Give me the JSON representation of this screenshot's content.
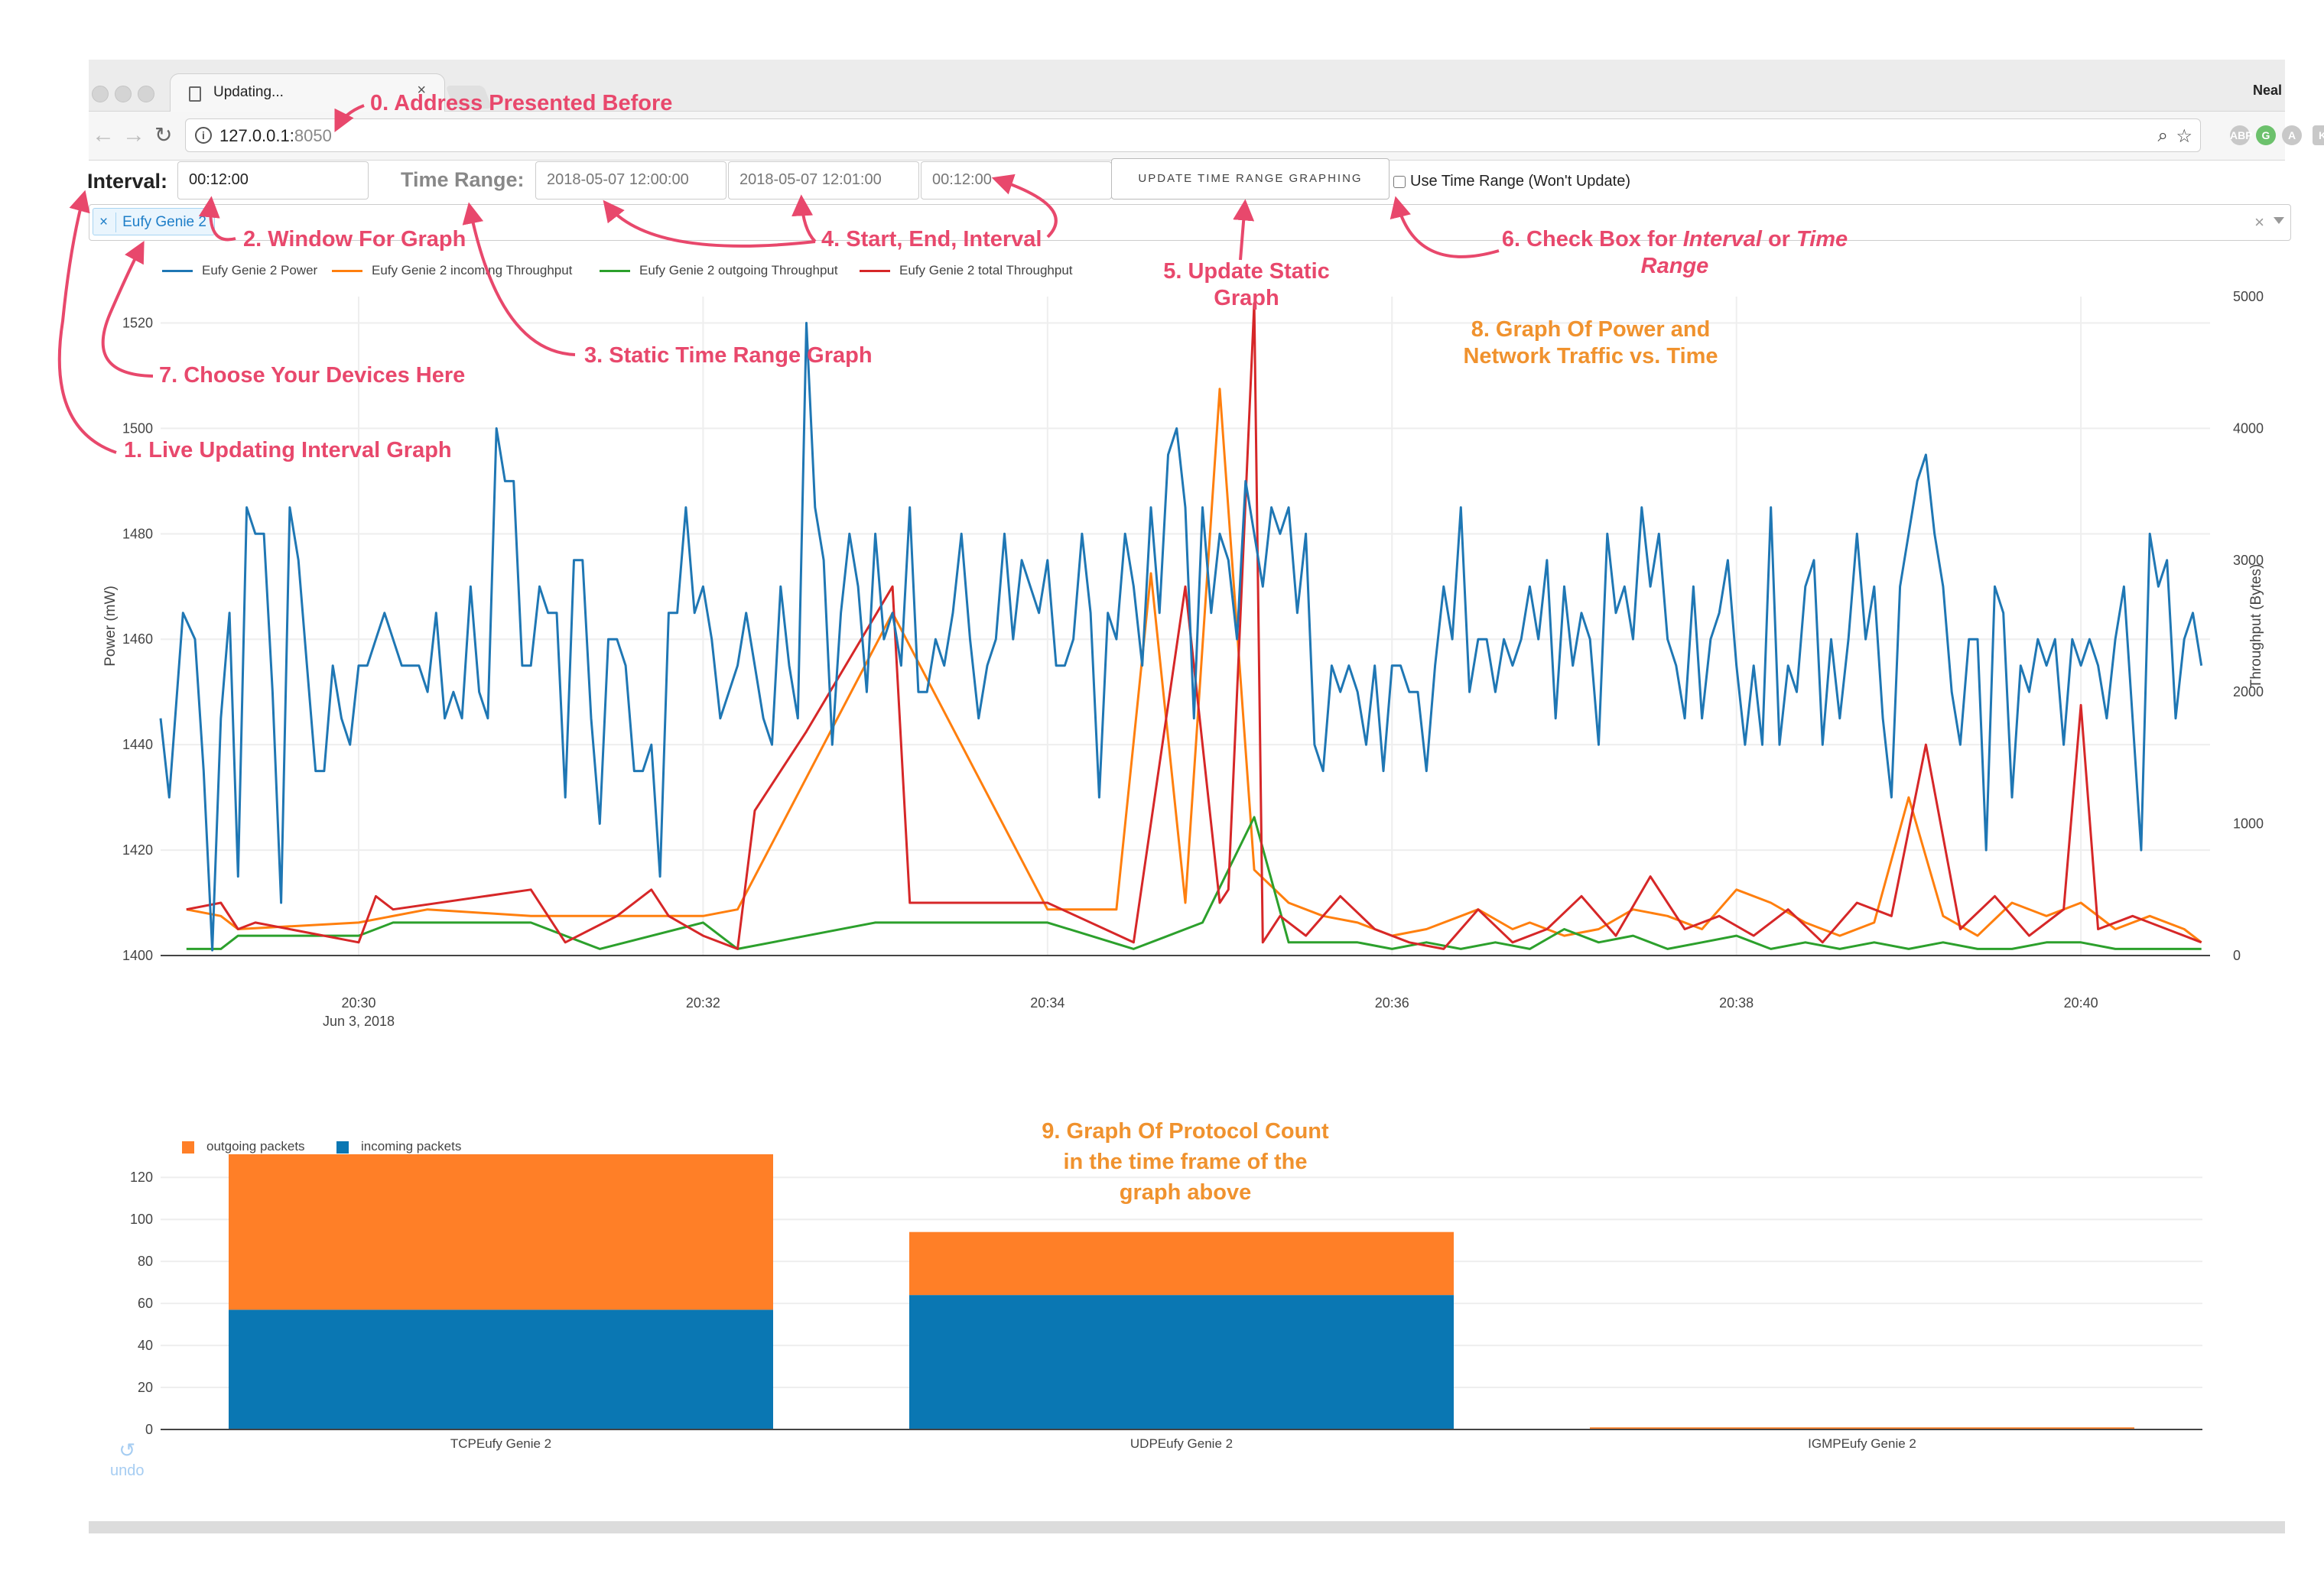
{
  "browser": {
    "tab_title": "Updating...",
    "profile_name": "Neal",
    "url_host": "127.0.0.1:",
    "url_port": "8050",
    "extensions": [
      "ABP",
      "G",
      "A",
      "K"
    ]
  },
  "controls": {
    "interval_label": "Interval:",
    "interval_value": "00:12:00",
    "time_range_label": "Time Range:",
    "start_value": "2018-05-07 12:00:00",
    "end_value": "2018-05-07 12:01:00",
    "range_interval_value": "00:12:00",
    "update_button": "UPDATE TIME RANGE GRAPHING",
    "checkbox_label": "Use Time Range (Won't Update)",
    "selected_device": "Eufy Genie 2"
  },
  "colors": {
    "power": "#1f77b4",
    "incoming": "#ff7f0e",
    "outgoing": "#2ca02c",
    "total": "#d62728",
    "annotation": "#e8486c",
    "annotation_orange": "#f0922e",
    "bar_outgoing": "#ff7f27",
    "bar_incoming": "#0a77b3"
  },
  "annotations": {
    "a0": "0. Address Presented Before",
    "a1": "1. Live Updating Interval Graph",
    "a2": "2. Window For Graph",
    "a3": "3. Static Time Range Graph",
    "a4": "4. Start, End, Interval",
    "a5_line1": "5. Update Static",
    "a5_line2": "Graph",
    "a6_prefix": "6. Check Box for ",
    "a6_em1": "Interval",
    "a6_mid": " or ",
    "a6_em2": "Time",
    "a6_line2": "Range",
    "a7": "7. Choose Your Devices Here",
    "a8_line1": "8. Graph Of Power and",
    "a8_line2": "Network Traffic vs. Time",
    "a9_line1": "9. Graph Of Protocol Count",
    "a9_line2": "in the time frame of the",
    "a9_line3": "graph above"
  },
  "undo_label": "undo",
  "chart_data": [
    {
      "type": "line",
      "ylabel": "Power (mW)",
      "y2label": "Throughput (Bytes)",
      "ylim": [
        1400,
        1525
      ],
      "y2lim": [
        0,
        5000
      ],
      "yticks": [
        1400,
        1420,
        1440,
        1460,
        1480,
        1500,
        1520
      ],
      "y2ticks": [
        0,
        1000,
        2000,
        3000,
        4000,
        5000
      ],
      "xlim_minutes": [
        28.85,
        40.75
      ],
      "xticks": [
        {
          "x": 30,
          "label": "20:30",
          "sub": "Jun 3, 2018"
        },
        {
          "x": 32,
          "label": "20:32",
          "sub": ""
        },
        {
          "x": 34,
          "label": "20:34",
          "sub": ""
        },
        {
          "x": 36,
          "label": "20:36",
          "sub": ""
        },
        {
          "x": 38,
          "label": "20:38",
          "sub": ""
        },
        {
          "x": 40,
          "label": "20:40",
          "sub": ""
        }
      ],
      "series": [
        {
          "name": "Eufy Genie 2 Power",
          "axis": "y",
          "color": "#1f77b4",
          "x": [
            28.85,
            28.9,
            28.98,
            29.05,
            29.1,
            29.15,
            29.2,
            29.25,
            29.3,
            29.35,
            29.4,
            29.45,
            29.5,
            29.55,
            29.6,
            29.65,
            29.7,
            29.75,
            29.8,
            29.85,
            29.9,
            29.95,
            30.0,
            30.05,
            30.1,
            30.15,
            30.2,
            30.25,
            30.3,
            30.35,
            30.4,
            30.45,
            30.5,
            30.55,
            30.6,
            30.65,
            30.7,
            30.75,
            30.8,
            30.85,
            30.9,
            30.95,
            31.0,
            31.05,
            31.1,
            31.15,
            31.2,
            31.25,
            31.3,
            31.35,
            31.4,
            31.45,
            31.5,
            31.55,
            31.6,
            31.65,
            31.7,
            31.75,
            31.8,
            31.85,
            31.9,
            31.95,
            32.0,
            32.05,
            32.1,
            32.15,
            32.2,
            32.25,
            32.3,
            32.35,
            32.4,
            32.45,
            32.5,
            32.55,
            32.6,
            32.65,
            32.7,
            32.75,
            32.8,
            32.85,
            32.9,
            32.95,
            33.0,
            33.05,
            33.1,
            33.15,
            33.2,
            33.25,
            33.3,
            33.35,
            33.4,
            33.45,
            33.5,
            33.55,
            33.6,
            33.65,
            33.7,
            33.75,
            33.8,
            33.85,
            33.9,
            33.95,
            34.0,
            34.05,
            34.1,
            34.15,
            34.2,
            34.25,
            34.3,
            34.35,
            34.4,
            34.45,
            34.5,
            34.55,
            34.6,
            34.65,
            34.7,
            34.75,
            34.8,
            34.85,
            34.9,
            34.95,
            35.0,
            35.05,
            35.1,
            35.15,
            35.2,
            35.25,
            35.3,
            35.35,
            35.4,
            35.45,
            35.5,
            35.55,
            35.6,
            35.65,
            35.7,
            35.75,
            35.8,
            35.85,
            35.9,
            35.95,
            36.0,
            36.05,
            36.1,
            36.15,
            36.2,
            36.25,
            36.3,
            36.35,
            36.4,
            36.45,
            36.5,
            36.55,
            36.6,
            36.65,
            36.7,
            36.75,
            36.8,
            36.85,
            36.9,
            36.95,
            37.0,
            37.05,
            37.1,
            37.15,
            37.2,
            37.25,
            37.3,
            37.35,
            37.4,
            37.45,
            37.5,
            37.55,
            37.6,
            37.65,
            37.7,
            37.75,
            37.8,
            37.85,
            37.9,
            37.95,
            38.0,
            38.05,
            38.1,
            38.15,
            38.2,
            38.25,
            38.3,
            38.35,
            38.4,
            38.45,
            38.5,
            38.55,
            38.6,
            38.65,
            38.7,
            38.75,
            38.8,
            38.85,
            38.9,
            38.95,
            39.0,
            39.05,
            39.1,
            39.15,
            39.2,
            39.25,
            39.3,
            39.35,
            39.4,
            39.45,
            39.5,
            39.55,
            39.6,
            39.65,
            39.7,
            39.75,
            39.8,
            39.85,
            39.9,
            39.95,
            40.0,
            40.05,
            40.1,
            40.15,
            40.2,
            40.25,
            40.3,
            40.35,
            40.4,
            40.45,
            40.5,
            40.55,
            40.6,
            40.65,
            40.7
          ],
          "y": [
            1445,
            1430,
            1465,
            1460,
            1435,
            1401,
            1445,
            1465,
            1415,
            1485,
            1480,
            1480,
            1450,
            1410,
            1485,
            1475,
            1455,
            1435,
            1435,
            1455,
            1445,
            1440,
            1455,
            1455,
            1460,
            1465,
            1460,
            1455,
            1455,
            1455,
            1450,
            1465,
            1445,
            1450,
            1445,
            1470,
            1450,
            1445,
            1500,
            1490,
            1490,
            1455,
            1455,
            1470,
            1465,
            1465,
            1430,
            1475,
            1475,
            1445,
            1425,
            1460,
            1460,
            1455,
            1435,
            1435,
            1440,
            1415,
            1465,
            1465,
            1485,
            1465,
            1470,
            1460,
            1445,
            1450,
            1455,
            1465,
            1455,
            1445,
            1440,
            1470,
            1455,
            1445,
            1520,
            1485,
            1475,
            1440,
            1465,
            1480,
            1470,
            1450,
            1480,
            1460,
            1465,
            1455,
            1485,
            1450,
            1450,
            1460,
            1455,
            1465,
            1480,
            1460,
            1445,
            1455,
            1460,
            1480,
            1460,
            1475,
            1470,
            1465,
            1475,
            1455,
            1455,
            1460,
            1480,
            1465,
            1430,
            1465,
            1460,
            1480,
            1470,
            1455,
            1485,
            1465,
            1495,
            1500,
            1485,
            1445,
            1485,
            1465,
            1480,
            1475,
            1460,
            1490,
            1480,
            1470,
            1485,
            1480,
            1485,
            1465,
            1480,
            1440,
            1435,
            1455,
            1450,
            1455,
            1450,
            1440,
            1455,
            1435,
            1455,
            1455,
            1450,
            1450,
            1435,
            1455,
            1470,
            1460,
            1485,
            1450,
            1460,
            1460,
            1450,
            1460,
            1455,
            1460,
            1470,
            1460,
            1475,
            1445,
            1470,
            1455,
            1465,
            1460,
            1440,
            1480,
            1465,
            1470,
            1460,
            1485,
            1470,
            1480,
            1460,
            1455,
            1445,
            1470,
            1445,
            1460,
            1465,
            1475,
            1455,
            1440,
            1455,
            1440,
            1485,
            1440,
            1455,
            1450,
            1470,
            1475,
            1440,
            1460,
            1445,
            1460,
            1480,
            1460,
            1470,
            1445,
            1430,
            1470,
            1480,
            1490,
            1495,
            1480,
            1470,
            1450,
            1440,
            1460,
            1460,
            1420,
            1470,
            1465,
            1430,
            1455,
            1450,
            1460,
            1455,
            1460,
            1440,
            1460,
            1455,
            1460,
            1455,
            1445,
            1460,
            1470,
            1445,
            1420,
            1480,
            1470,
            1475,
            1445,
            1460,
            1465,
            1455
          ],
          "x_override": true
        },
        {
          "name": "Eufy Genie 2 incoming Throughput",
          "axis": "y2",
          "color": "#ff7f0e",
          "x": [
            29.0,
            29.2,
            29.3,
            30.0,
            30.4,
            31.0,
            31.6,
            32.0,
            32.2,
            33.1,
            34.0,
            34.4,
            34.6,
            34.8,
            35.0,
            35.2,
            35.4,
            35.6,
            35.8,
            36.0,
            36.2,
            36.5,
            36.7,
            36.8,
            37.0,
            37.2,
            37.4,
            37.6,
            37.8,
            38.0,
            38.2,
            38.4,
            38.6,
            38.8,
            39.0,
            39.2,
            39.4,
            39.6,
            39.8,
            40.0,
            40.2,
            40.4,
            40.6,
            40.7
          ],
          "y": [
            350,
            300,
            200,
            250,
            350,
            300,
            300,
            300,
            350,
            2600,
            350,
            350,
            2900,
            400,
            4300,
            650,
            400,
            300,
            250,
            150,
            200,
            350,
            200,
            250,
            150,
            200,
            350,
            300,
            200,
            500,
            400,
            250,
            150,
            250,
            1200,
            300,
            150,
            400,
            300,
            400,
            200,
            300,
            200,
            100
          ]
        },
        {
          "name": "Eufy Genie 2 outgoing Throughput",
          "axis": "y2",
          "color": "#2ca02c",
          "x": [
            29.0,
            29.2,
            29.3,
            30.0,
            30.2,
            31.0,
            31.4,
            32.0,
            32.2,
            33.0,
            34.0,
            34.5,
            34.9,
            35.2,
            35.4,
            35.8,
            36.0,
            36.2,
            36.4,
            36.6,
            36.8,
            37.0,
            37.2,
            37.4,
            37.6,
            37.8,
            38.0,
            38.2,
            38.4,
            38.6,
            38.8,
            39.0,
            39.2,
            39.4,
            39.6,
            39.8,
            40.0,
            40.2,
            40.4,
            40.6,
            40.7
          ],
          "y": [
            50,
            50,
            150,
            150,
            250,
            250,
            50,
            250,
            50,
            250,
            250,
            50,
            250,
            1050,
            100,
            100,
            50,
            100,
            50,
            100,
            50,
            200,
            100,
            150,
            50,
            100,
            150,
            50,
            100,
            50,
            100,
            50,
            100,
            50,
            50,
            100,
            100,
            50,
            50,
            50,
            50
          ]
        },
        {
          "name": "Eufy Genie 2 total Throughput",
          "axis": "y2",
          "color": "#d62728",
          "x": [
            29.0,
            29.2,
            29.3,
            29.4,
            30.0,
            30.1,
            30.2,
            31.0,
            31.2,
            31.5,
            31.7,
            31.8,
            32.0,
            32.2,
            32.3,
            32.6,
            33.1,
            33.2,
            34.0,
            34.5,
            34.8,
            35.0,
            35.05,
            35.2,
            35.25,
            35.35,
            35.5,
            35.7,
            35.9,
            36.1,
            36.3,
            36.5,
            36.7,
            36.9,
            37.1,
            37.3,
            37.5,
            37.7,
            37.9,
            38.1,
            38.3,
            38.5,
            38.7,
            38.9,
            39.1,
            39.3,
            39.5,
            39.7,
            39.9,
            40.0,
            40.1,
            40.3,
            40.5,
            40.7
          ],
          "y": [
            350,
            400,
            200,
            250,
            100,
            450,
            350,
            500,
            100,
            300,
            500,
            300,
            150,
            50,
            1100,
            1700,
            2800,
            400,
            400,
            100,
            2800,
            400,
            500,
            4950,
            100,
            300,
            150,
            450,
            200,
            100,
            50,
            350,
            100,
            200,
            450,
            150,
            600,
            200,
            300,
            150,
            350,
            100,
            400,
            300,
            1600,
            200,
            450,
            150,
            350,
            1900,
            200,
            300,
            200,
            100
          ]
        }
      ],
      "legend_position": "top-left",
      "grid": true
    },
    {
      "type": "bar",
      "stacked": true,
      "categories": [
        "TCPEufy Genie 2",
        "UDPEufy Genie 2",
        "IGMPEufy Genie 2"
      ],
      "series": [
        {
          "name": "incoming packets",
          "color": "#0a77b3",
          "values": [
            57,
            64,
            0
          ]
        },
        {
          "name": "outgoing packets",
          "color": "#ff7f27",
          "values": [
            74,
            30,
            1
          ]
        }
      ],
      "ylim": [
        0,
        131
      ],
      "yticks": [
        0,
        20,
        40,
        60,
        80,
        100,
        120
      ],
      "legend_position": "top-left",
      "grid": true
    }
  ]
}
